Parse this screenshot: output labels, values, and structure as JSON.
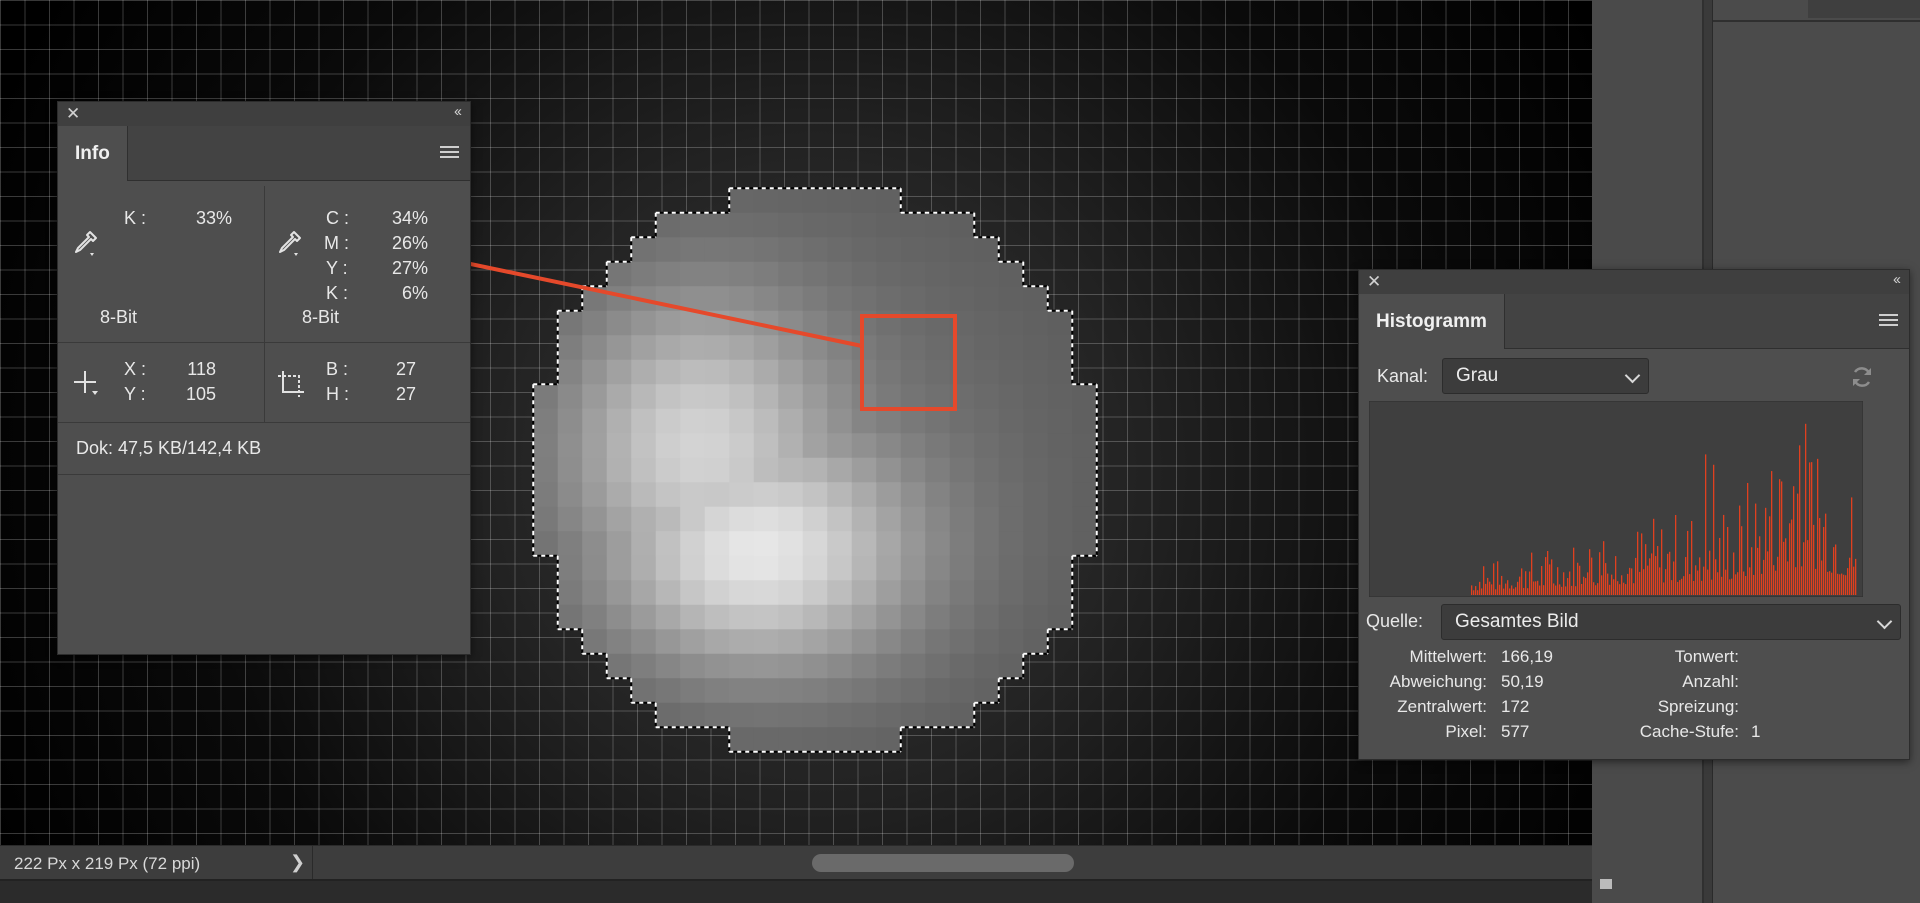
{
  "info_panel": {
    "tab": "Info",
    "close_glyph": "✕",
    "collapse_glyph": "‹‹",
    "gray": {
      "label": "K :",
      "value": "33%",
      "bitdepth": "8-Bit"
    },
    "cmyk": {
      "c_label": "C :",
      "c_value": "34%",
      "m_label": "M :",
      "m_value": "26%",
      "y_label": "Y :",
      "y_value": "27%",
      "k_label": "K :",
      "k_value": "6%",
      "bitdepth": "8-Bit"
    },
    "position": {
      "x_label": "X :",
      "x_value": "118",
      "y_label": "Y :",
      "y_value": "105"
    },
    "size": {
      "w_label": "B :",
      "w_value": "27",
      "h_label": "H :",
      "h_value": "27"
    },
    "doc": "Dok: 47,5 KB/142,4 KB"
  },
  "histogram_panel": {
    "tab": "Histogramm",
    "close_glyph": "✕",
    "collapse_glyph": "‹‹",
    "channel_label": "Kanal:",
    "channel_value": "Grau",
    "source_label": "Quelle:",
    "source_value": "Gesamtes Bild",
    "stats": {
      "mean_label": "Mittelwert:",
      "mean_value": "166,19",
      "std_label": "Abweichung:",
      "std_value": "50,19",
      "median_label": "Zentralwert:",
      "median_value": "172",
      "pixel_label": "Pixel:",
      "pixel_value": "577",
      "level_label": "Tonwert:",
      "level_value": "",
      "count_label": "Anzahl:",
      "count_value": "",
      "percentile_label": "Spreizung:",
      "percentile_value": "",
      "cache_label": "Cache-Stufe:",
      "cache_value": "1"
    },
    "histogram_color": "#e0401f"
  },
  "status_bar": {
    "doc_size": "222 Px x 219 Px (72 ppi)",
    "arrow_glyph": "❯"
  },
  "colors": {
    "accent": "#e5492b",
    "panel_bg": "#4e4e4e",
    "selection": "#ffffff"
  },
  "icons": [
    "eyedropper-icon",
    "crosshair-icon",
    "selection-size-icon",
    "refresh-icon",
    "panel-menu-icon",
    "close-icon",
    "collapse-icon"
  ]
}
